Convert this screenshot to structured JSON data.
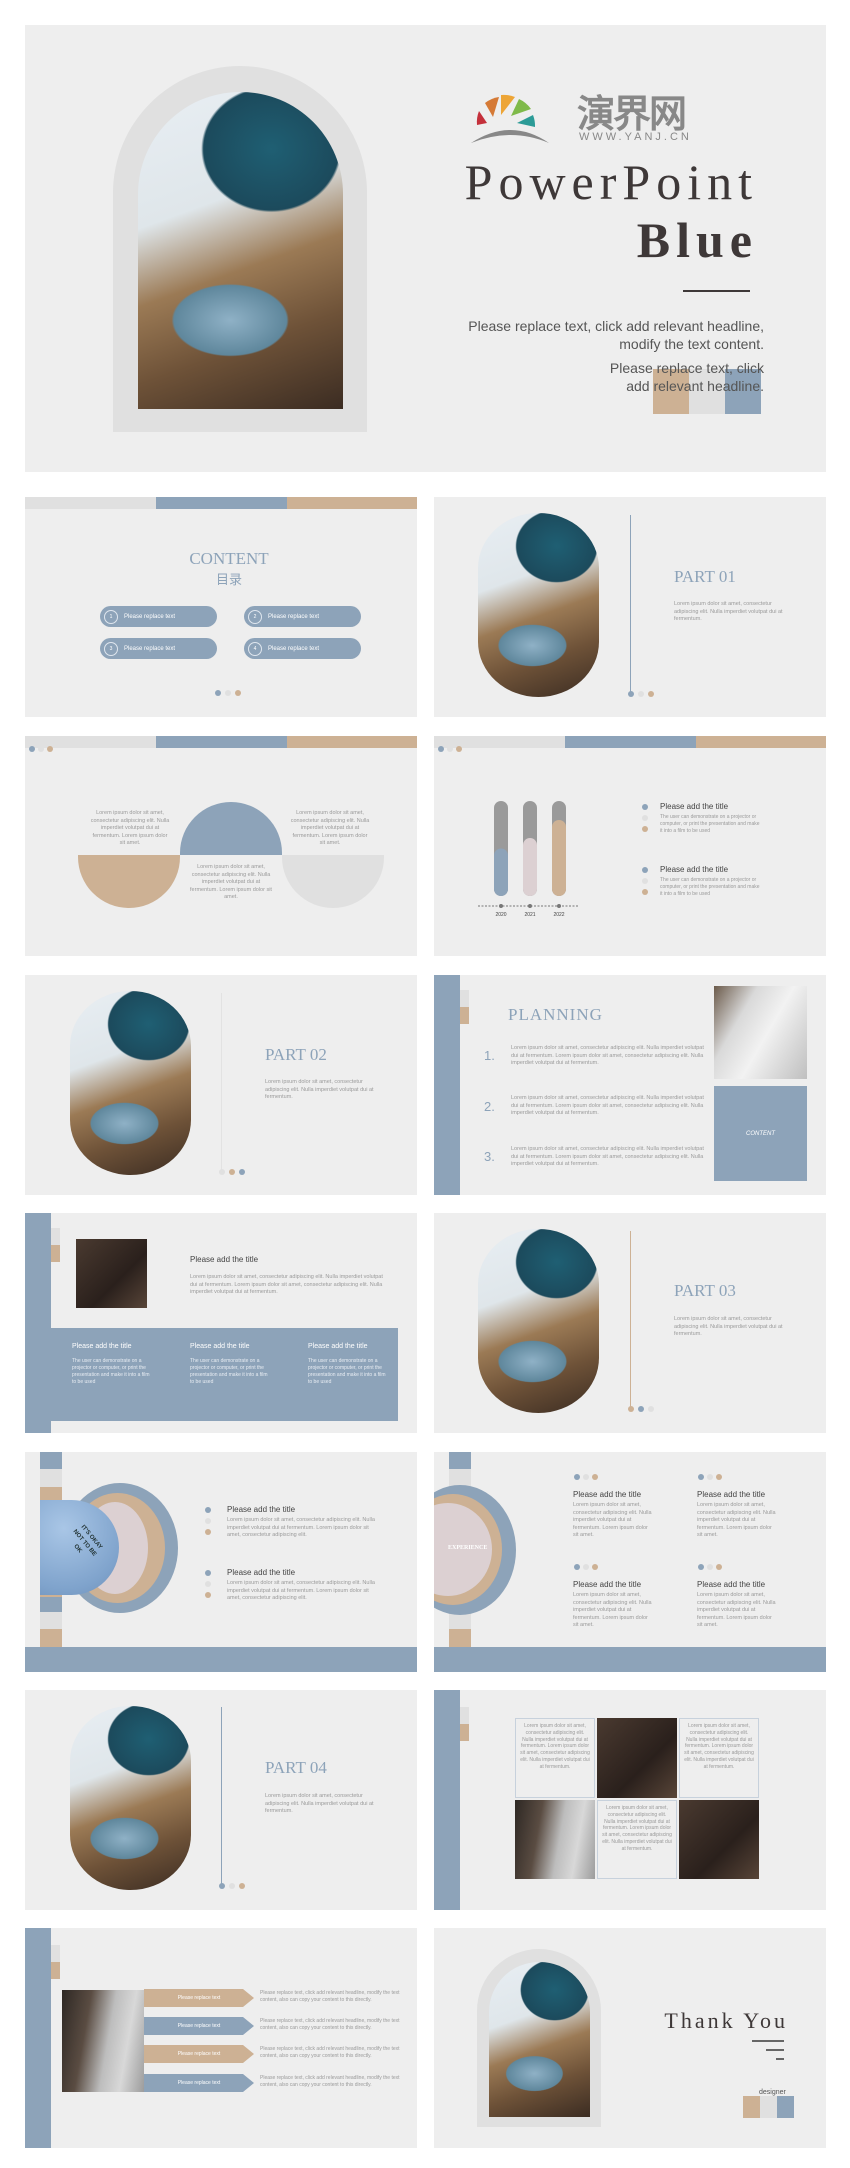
{
  "colors": {
    "blue": "#8da3b9",
    "tan": "#cdb194",
    "gray": "#e0e0e0",
    "pink": "#dcd0d2",
    "slide_bg": "#eeeeee",
    "text_dark": "#3e3838"
  },
  "cover": {
    "logo_cn": "演界网",
    "logo_url": "WWW.YANJ.CN",
    "title_line1": "PowerPoint",
    "title_line2": "Blue",
    "para1": "Please replace text, click add relevant headline, modify the text content.",
    "para2": "Please replace text, click add relevant headline."
  },
  "contents": {
    "title": "CONTENT",
    "subtitle": "目录",
    "items": [
      {
        "num": "1",
        "label": "Please replace text"
      },
      {
        "num": "2",
        "label": "Please replace text"
      },
      {
        "num": "3",
        "label": "Please replace text"
      },
      {
        "num": "4",
        "label": "Please replace text"
      }
    ]
  },
  "lorem_short": "Lorem ipsum dolor sit amet, consectetur adipiscing elit. Nulla imperdiet volutpat dui at fermentum.",
  "lorem_semi": "Lorem ipsum dolor sit amet, consectetur adipiscing elit. Nulla imperdiet volutpat dui at fermentum. Lorem ipsum dolor sit amet.",
  "lorem_long": "Lorem ipsum dolor sit amet, consectetur adipiscing elit. Nulla imperdiet volutpat dui at fermentum. Lorem ipsum dolor sit amet, consectetur adipiscing elit. Nulla imperdiet volutpat dui at fermentum.",
  "lorem_item": "Lorem ipsum dolor sit amet, consectetur adipiscing elit. Nulla imperdiet volutpat dui at fermentum. Lorem ipsum dolor sit amet, consectetur adipiscing elit.",
  "parts": [
    "PART 01",
    "PART 02",
    "PART 03",
    "PART 04"
  ],
  "add_title": "Please add the title",
  "demo_text": "The user can demonstrate on a projector or computer, or print the presentation and make it into a film to be used",
  "chart_data": {
    "type": "bar",
    "categories": [
      "2020",
      "2021",
      "2022"
    ],
    "values": [
      50,
      61,
      80
    ],
    "ylim": [
      0,
      100
    ]
  },
  "planning": {
    "title": "PLANNING",
    "numbers": [
      "1.",
      "2.",
      "3."
    ],
    "box_label": "CONTENT"
  },
  "circle_slide": {
    "photo_lettering": "IT'S OKAY NOT TO BE OK",
    "experience": "EXPERIENCE"
  },
  "arrows": {
    "label": "Please replace text",
    "desc": "Please replace text, click add relevant headline, modify the text content, also can copy your content to this directly."
  },
  "thanks": {
    "title": "Thank You",
    "designer": "designer"
  }
}
